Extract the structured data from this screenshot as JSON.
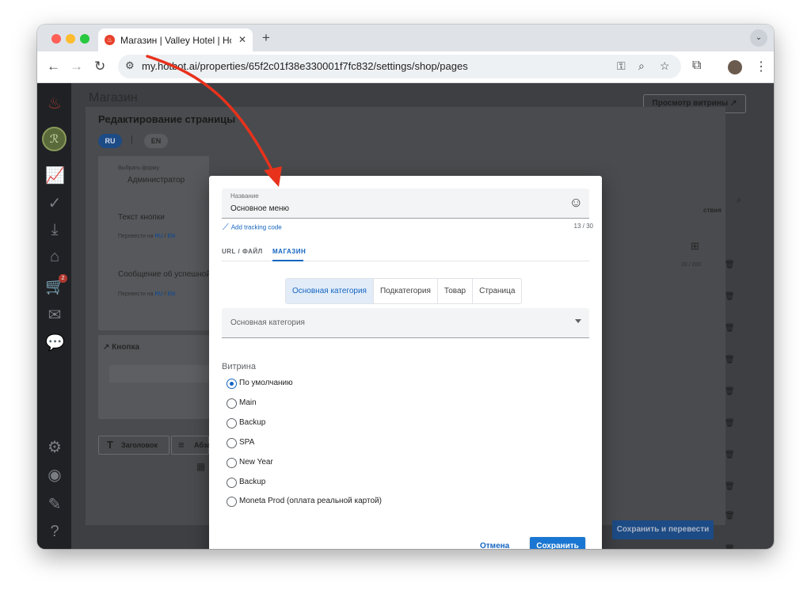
{
  "browser": {
    "tab_title": "Магазин | Valley Hotel | Hotbot",
    "url": "my.hotbot.ai/properties/65f2c01f38e330001f7fc832/settings/shop/pages",
    "new_tab_symbol": "+",
    "close_symbol": "✕"
  },
  "colors": {
    "accent": "#1976d2",
    "accent_text": "#1565c0",
    "annotation_arrow": "#e8321c",
    "badge": "#e53935"
  },
  "sidebar": {
    "icons": [
      "flame-icon",
      "logo-icon",
      "analytics-icon",
      "check-icon",
      "inbox-icon",
      "tray-icon",
      "cart-icon",
      "mail-icon",
      "chat-icon",
      "settings-icon",
      "user-icon",
      "pen-icon",
      "help-icon"
    ],
    "cart_badge": "2"
  },
  "background": {
    "page_title": "Магазин",
    "preview_button": "Просмотр витрины ↗",
    "panel_title": "Редактирование страницы",
    "lang_ru": "RU",
    "lang_en": "EN",
    "form_label": "Выбрать форму",
    "form_value": "Администратор",
    "button_text_label": "Текст кнопки",
    "translate_label": "Перевести на",
    "success_msg_label": "Сообщение об успешной",
    "button_section": "Кнопка",
    "heading_btn": "Заголовок",
    "paragraph_btn": "Абза",
    "save_translate": "Сохранить и перевести",
    "actions_col": "ствия",
    "right_counter": "20 / 200"
  },
  "modal": {
    "name_label": "Название",
    "name_value": "Основное меню",
    "add_tracking": "Add tracking code",
    "counter": "13 / 30",
    "tabs": [
      "URL / ФАЙЛ",
      "МАГАЗИН"
    ],
    "active_tab": "МАГАЗИН",
    "segments": [
      "Основная категория",
      "Подкатегория",
      "Товар",
      "Страница"
    ],
    "active_segment": "Основная категория",
    "select_label": "Основная категория",
    "showcase_label": "Витрина",
    "radios": [
      "По умолчанию",
      "Main",
      "Backup",
      "SPA",
      "New Year",
      "Backup",
      "Moneta Prod (оплата реальной картой)"
    ],
    "selected_radio": "По умолчанию",
    "cancel": "Отмена",
    "save": "Сохранить"
  }
}
